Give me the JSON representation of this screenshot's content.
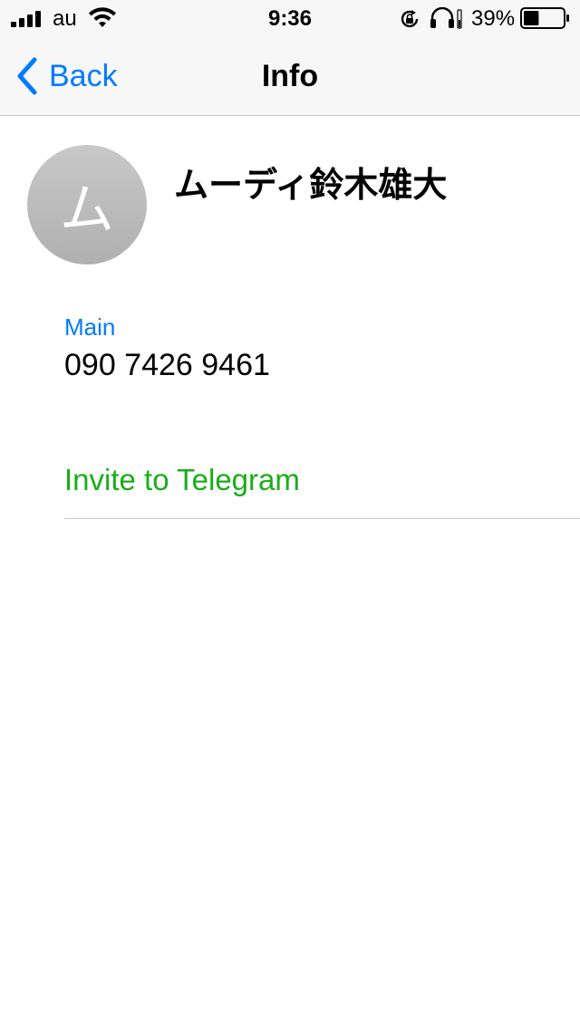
{
  "status_bar": {
    "carrier": "au",
    "time": "9:36",
    "battery_percent": "39%",
    "battery_level": 0.39,
    "icons": [
      "signal-icon",
      "wifi-icon",
      "rotation-lock-icon",
      "headphones-icon",
      "battery-icon"
    ]
  },
  "nav": {
    "back_label": "Back",
    "title": "Info"
  },
  "contact": {
    "avatar_initial": "ム",
    "name": "ムーディ鈴木雄大",
    "phone_label": "Main",
    "phone_number": "090 7426 9461"
  },
  "actions": {
    "invite_label": "Invite to Telegram"
  },
  "colors": {
    "accent_blue": "#007aff",
    "invite_green": "#1aad19",
    "avatar_gray": "#bdbdbd"
  }
}
